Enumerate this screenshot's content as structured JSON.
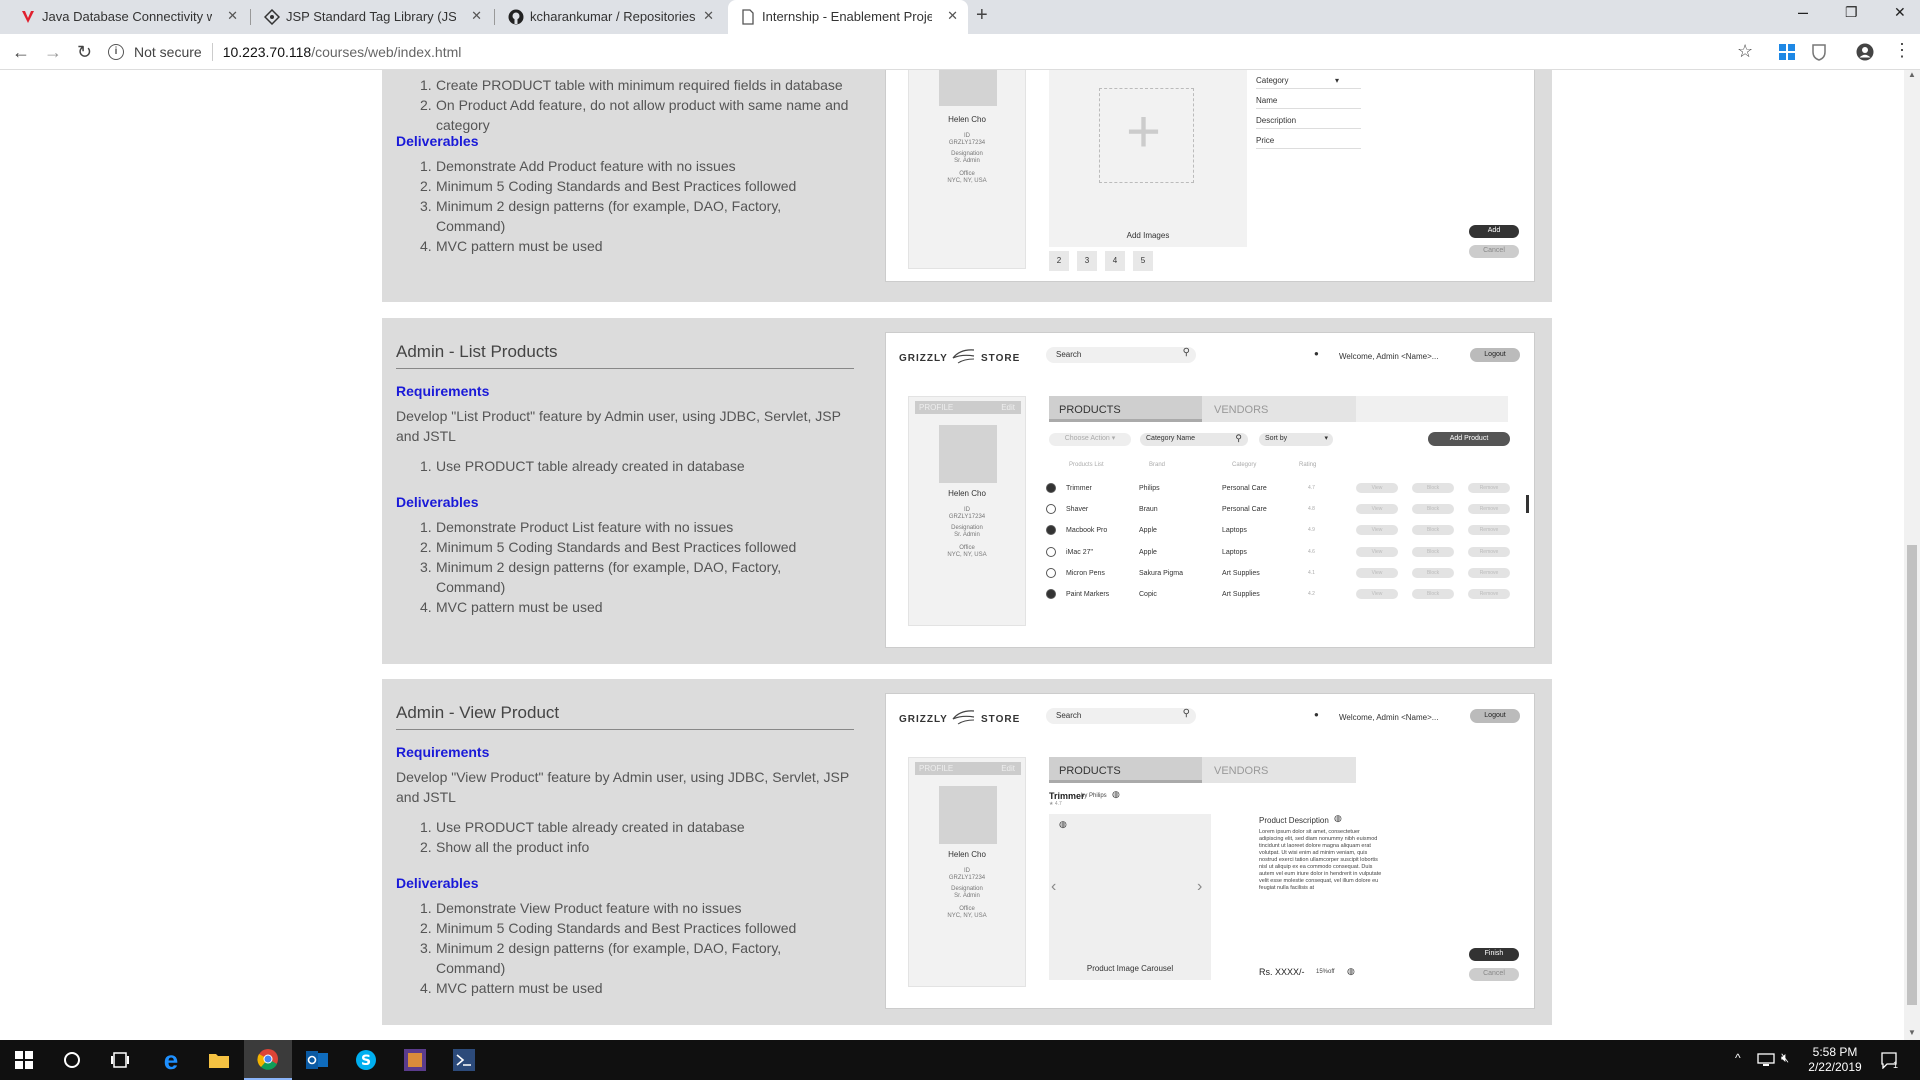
{
  "browser": {
    "tabs": [
      {
        "title": "Java Database Connectivity with",
        "icon": "vivaldi-icon"
      },
      {
        "title": "JSP Standard Tag Library (JSTL) T",
        "icon": "diamond-icon"
      },
      {
        "title": "kcharankumar / Repositories",
        "icon": "github-icon"
      },
      {
        "title": "Internship - Enablement Project",
        "icon": "page-icon"
      }
    ],
    "security_label": "Not secure",
    "url_host": "10.223.70.118",
    "url_path": "/courses/web/index.html"
  },
  "top_section": {
    "req_items": [
      "Create PRODUCT table with minimum required fields in database",
      "On Product Add feature, do not allow product with same name and category"
    ],
    "deliverables_label": "Deliverables",
    "deliverables": [
      "Demonstrate Add Product feature with no issues",
      "Minimum 5 Coding Standards and Best Practices followed",
      "Minimum 2 design patterns (for example, DAO, Factory, Command)",
      "MVC pattern must be used"
    ],
    "mock": {
      "profile_name": "Helen Cho",
      "id_label": "ID",
      "id_value": "GRZLY17234",
      "designation_label": "Designation",
      "designation_value": "Sr. Admin",
      "office_label": "Office",
      "office_value": "NYC, NY, USA",
      "add_images": "Add Images",
      "thumbs": [
        "2",
        "3",
        "4",
        "5"
      ],
      "fields": [
        "Category",
        "Name",
        "Description",
        "Price"
      ],
      "add_btn": "Add",
      "cancel_btn": "Cancel"
    }
  },
  "list_section": {
    "title": "Admin - List Products",
    "requirements_label": "Requirements",
    "requirements_text": "Develop \"List Product\" feature by Admin user, using JDBC, Servlet, JSP and JSTL",
    "req_items": [
      "Use PRODUCT table already created in database"
    ],
    "deliverables_label": "Deliverables",
    "deliverables": [
      "Demonstrate Product List feature with no issues",
      "Minimum 5 Coding Standards and Best Practices followed",
      "Minimum 2 design patterns (for example, DAO, Factory, Command)",
      "MVC pattern must be used"
    ],
    "mock": {
      "brand_left": "GRIZZLY",
      "brand_right": "STORE",
      "search_placeholder": "Search",
      "welcome": "Welcome, Admin <Name>...",
      "logout": "Logout",
      "profile_header": "PROFILE",
      "profile_edit": "Edit",
      "profile_name": "Helen Cho",
      "id_label": "ID",
      "id_value": "GRZLY17234",
      "designation_label": "Designation",
      "designation_value": "Sr. Admin",
      "office_label": "Office",
      "office_value": "NYC, NY, USA",
      "tab_products": "PRODUCTS",
      "tab_vendors": "VENDORS",
      "choose_action": "Choose Action",
      "category_name": "Category Name",
      "sort_by": "Sort by",
      "add_product": "Add Product",
      "columns": [
        "Products List",
        "Brand",
        "Category",
        "Rating"
      ],
      "rows": [
        {
          "name": "Trimmer",
          "brand": "Philips",
          "category": "Personal Care",
          "rating": "4.7",
          "checked": true
        },
        {
          "name": "Shaver",
          "brand": "Braun",
          "category": "Personal Care",
          "rating": "4.8",
          "checked": false
        },
        {
          "name": "Macbook Pro",
          "brand": "Apple",
          "category": "Laptops",
          "rating": "4.9",
          "checked": true
        },
        {
          "name": "iMac 27\"",
          "brand": "Apple",
          "category": "Laptops",
          "rating": "4.6",
          "checked": false
        },
        {
          "name": "Micron Pens",
          "brand": "Sakura Pigma",
          "category": "Art Supplies",
          "rating": "4.1",
          "checked": false
        },
        {
          "name": "Paint Markers",
          "brand": "Copic",
          "category": "Art Supplies",
          "rating": "4.2",
          "checked": true
        }
      ],
      "row_actions": [
        "View",
        "Block",
        "Remove"
      ]
    }
  },
  "view_section": {
    "title": "Admin - View Product",
    "requirements_label": "Requirements",
    "requirements_text": "Develop \"View Product\" feature by Admin user, using JDBC, Servlet, JSP and JSTL",
    "req_items": [
      "Use PRODUCT table already created in database",
      "Show all the product info"
    ],
    "deliverables_label": "Deliverables",
    "deliverables": [
      "Demonstrate View Product feature with no issues",
      "Minimum 5 Coding Standards and Best Practices followed",
      "Minimum 2 design patterns (for example, DAO, Factory, Command)",
      "MVC pattern must be used"
    ],
    "mock": {
      "brand_left": "GRIZZLY",
      "brand_right": "STORE",
      "search_placeholder": "Search",
      "welcome": "Welcome, Admin <Name>...",
      "logout": "Logout",
      "profile_header": "PROFILE",
      "profile_edit": "Edit",
      "profile_name": "Helen Cho",
      "id_label": "ID",
      "id_value": "GRZLY17234",
      "designation_label": "Designation",
      "designation_value": "Sr. Admin",
      "office_label": "Office",
      "office_value": "NYC, NY, USA",
      "tab_products": "PRODUCTS",
      "tab_vendors": "VENDORS",
      "product_name": "Trimmer",
      "by_brand": "by Philips",
      "rating": "4.7",
      "carousel_label": "Product Image Carousel",
      "desc_title": "Product Description",
      "desc_text": "Lorem ipsum dolor sit amet, consectetuer adipiscing elit, sed diam nonummy nibh euismod tincidunt ut laoreet dolore magna aliquam erat volutpat. Ut wisi enim ad minim veniam, quis nostrud exerci tation ullamcorper suscipit lobortis nisl ut aliquip ex ea commodo consequat. Duis autem vel eum iriure dolor in hendrerit in vulputate velit esse molestie consequat, vel illum dolore eu feugiat nulla facilisis at",
      "price": "Rs. XXXX/-",
      "discount": "15%off",
      "finish_btn": "Finish",
      "cancel_btn": "Cancel"
    }
  },
  "taskbar": {
    "time": "5:58 PM",
    "date": "2/22/2019",
    "notification_count": "1"
  }
}
